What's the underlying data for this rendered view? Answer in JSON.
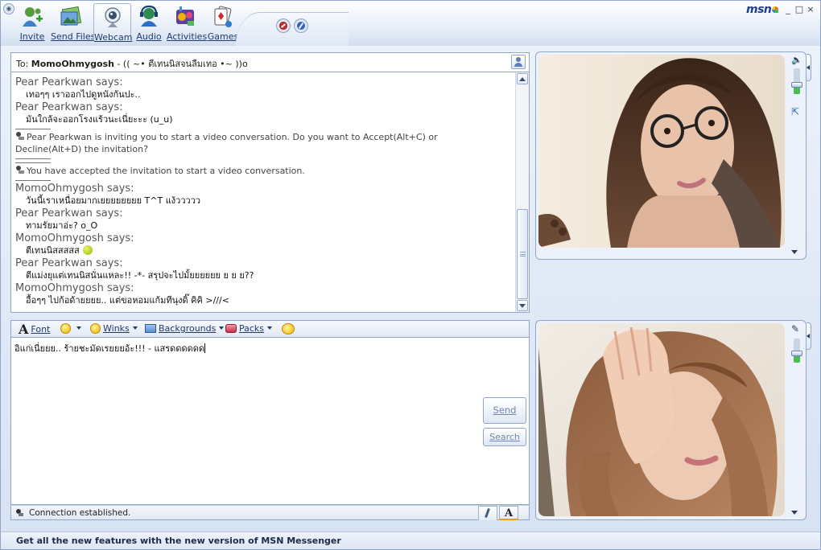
{
  "toolbar": {
    "items": [
      {
        "label": "Invite",
        "icon": "invite-icon"
      },
      {
        "label": "Send Files",
        "icon": "send-files-icon"
      },
      {
        "label": "Webcam",
        "icon": "webcam-icon"
      },
      {
        "label": "Audio",
        "icon": "audio-icon"
      },
      {
        "label": "Activities",
        "icon": "activities-icon"
      },
      {
        "label": "Games",
        "icon": "games-icon"
      }
    ],
    "active_item": "Webcam"
  },
  "brand": {
    "logo_text": "msn"
  },
  "window_controls": {
    "minimize": "_",
    "maximize": "□",
    "close": "×"
  },
  "conversation": {
    "to_label": "To:",
    "to_name": "MomoOhmygosh",
    "to_status": " - ((  ~• ตีเทนนิสจนลืมเทอ •~  ))o",
    "messages": [
      {
        "type": "msg",
        "sender": "Pear Pearkwan says:",
        "text": "เทอๆๆ เราออกไปดูหนังกันปะ.."
      },
      {
        "type": "msg",
        "sender": "Pear Pearkwan says:",
        "text": "มันใกล้จะออกโรงแร้วนะเนี่ยะะะ (u_u)"
      },
      {
        "type": "sys",
        "text": "Pear Pearkwan is inviting you to start a video conversation. Do you want to Accept(Alt+C) or Decline(Alt+D) the invitation?"
      },
      {
        "type": "sys",
        "text": "You have accepted the invitation to start a video conversation."
      },
      {
        "type": "msg",
        "sender": "MomoOhmygosh says:",
        "text": "วันนี้เราเหนื่อยมากเยยยยยยยย T^T แง้ววววว"
      },
      {
        "type": "msg",
        "sender": "Pear Pearkwan says:",
        "text": "ทามรัยมาอ่ะ? o_O"
      },
      {
        "type": "msg",
        "sender": "MomoOhmygosh says:",
        "text": "ตีเทนนิสสสสส",
        "emoticon": "tennis-ball-icon"
      },
      {
        "type": "msg",
        "sender": "Pear Pearkwan says:",
        "text": "ตีแม่งยุแต่เทนนิสนั่นแหละ!! -*- สรุปจะไปมั้ยยยยยย ย ย ย??"
      },
      {
        "type": "msg",
        "sender": "MomoOhmygosh says:",
        "text": "อื้อๆๆ ไปก้อด้ายยยย.. แต่ขอหอมแก้มทีนุงดิ๊ คิคิ >///<"
      }
    ]
  },
  "format_bar": {
    "font": "Font",
    "winks": "Winks",
    "backgrounds": "Backgrounds",
    "packs": "Packs"
  },
  "compose": {
    "text": "อิแก่เนี่ยยย.. ร้ายชะมัดเรยยยอ้ะ!!! - แสรดดดดดด",
    "send_label": "Send",
    "search_label": "Search"
  },
  "status": {
    "text": "Connection established."
  },
  "footer": {
    "text": "Get all the new features with the new version of MSN Messenger"
  },
  "webcam": {
    "remote": {
      "volume_level": 0.35
    },
    "local": {
      "volume_level": 0.35
    }
  },
  "colors": {
    "frame_border": "#8ea6cc",
    "accent": "#1e3a6e",
    "level_green": "#4dbd4f"
  }
}
